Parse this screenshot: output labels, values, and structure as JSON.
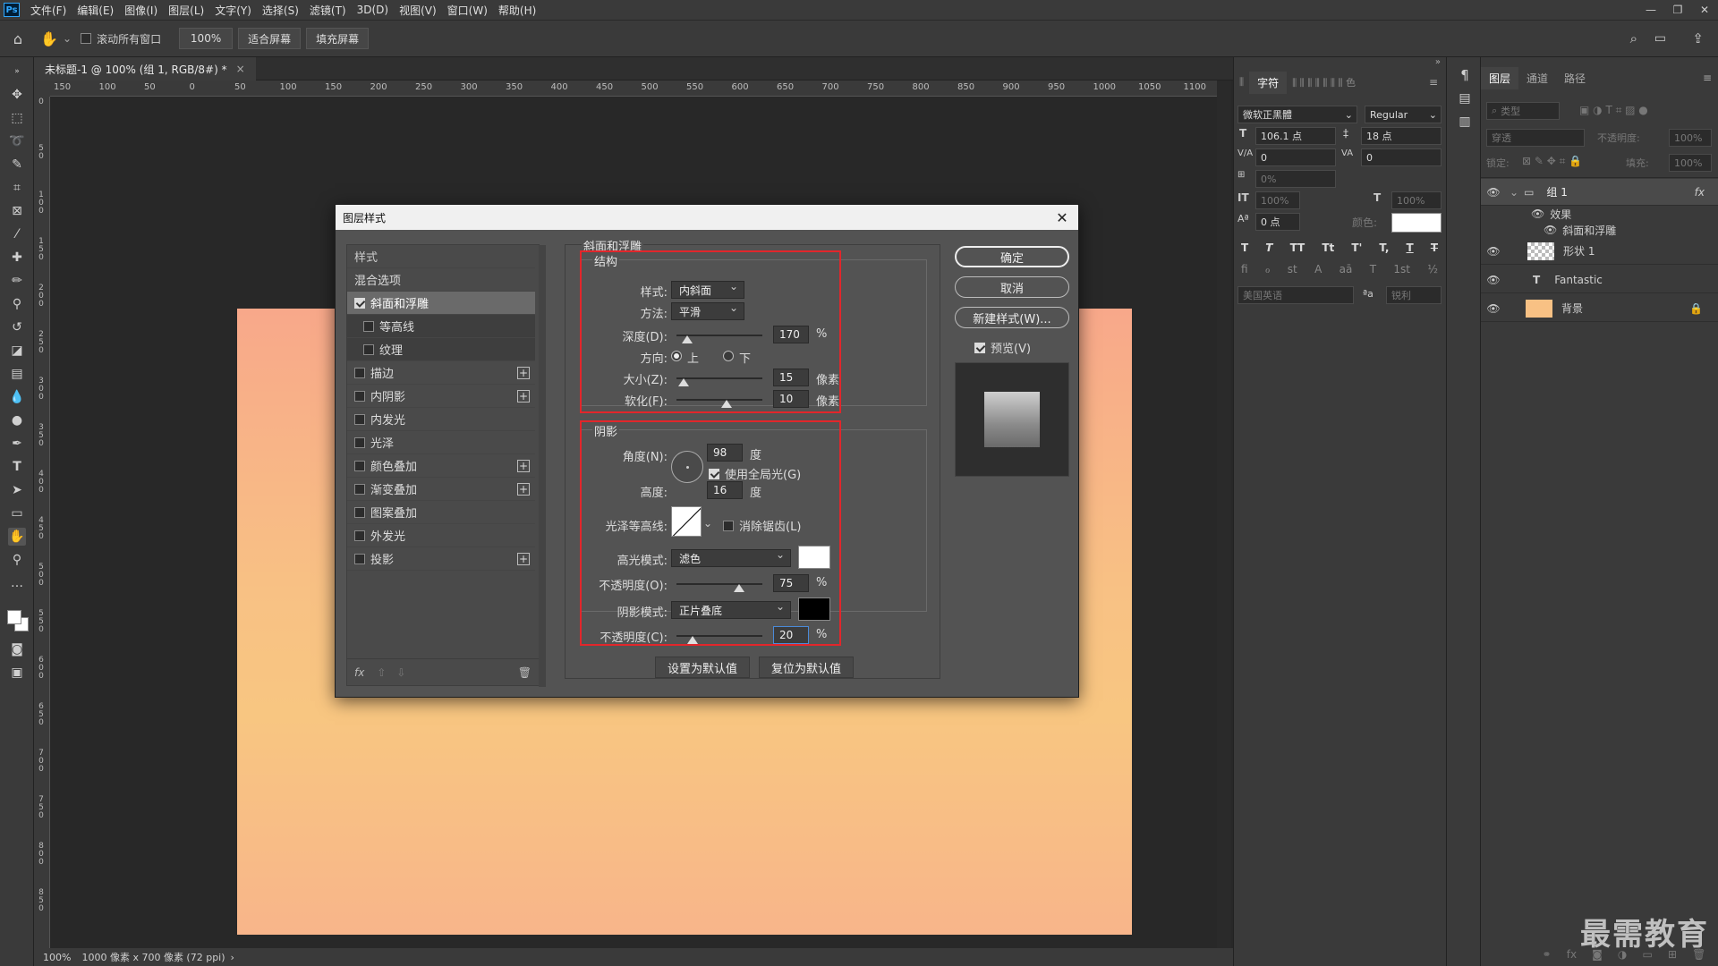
{
  "app": {
    "logo": "Ps",
    "menu": [
      "文件(F)",
      "编辑(E)",
      "图像(I)",
      "图层(L)",
      "文字(Y)",
      "选择(S)",
      "滤镜(T)",
      "3D(D)",
      "视图(V)",
      "窗口(W)",
      "帮助(H)"
    ],
    "win_controls": [
      "—",
      "❐",
      "✕"
    ]
  },
  "options": {
    "scroll_all": "滚动所有窗口",
    "zoom": "100%",
    "fit_screen": "适合屏幕",
    "fill_screen": "填充屏幕"
  },
  "document": {
    "tab_title": "未标题-1 @ 100% (组 1, RGB/8#) *",
    "tab_close": "×"
  },
  "rulers": {
    "h": [
      "150",
      "100",
      "50",
      "0",
      "50",
      "100",
      "150",
      "200",
      "250",
      "300",
      "350",
      "400",
      "450",
      "500",
      "550",
      "600",
      "650",
      "700",
      "750",
      "800",
      "850",
      "900",
      "950",
      "1000",
      "1050",
      "1100"
    ],
    "v": [
      "0",
      "5 0",
      "1 0 0",
      "1 5 0",
      "2 0 0",
      "2 5 0",
      "3 0 0",
      "3 5 0",
      "4 0 0",
      "4 5 0",
      "5 0 0",
      "5 5 0",
      "6 0 0",
      "6 5 0",
      "7 0 0",
      "7 5 0",
      "8 0 0",
      "8 5 0"
    ]
  },
  "status": {
    "zoom": "100%",
    "info": "1000 像素 x 700 像素 (72 ppi)",
    "arrow": "›"
  },
  "char_panel": {
    "tabs": [
      "字符"
    ],
    "font": "微软正黑體",
    "style": "Regular",
    "size": "106.1 点",
    "leading": "18 点",
    "kerning": "0",
    "tracking": "0",
    "scale": "0%",
    "v_scale": "100%",
    "h_scale": "100%",
    "baseline": "0 点",
    "color_label": "颜色:",
    "color": "#ffffff",
    "lang": "美国英语",
    "aa_label": "ªa",
    "aa": "锐利",
    "t_styles": [
      "T",
      "T",
      "TT",
      "Tt",
      "T'",
      "T,",
      "T",
      "T"
    ],
    "ot_styles": [
      "fi",
      "ℴ",
      "st",
      "A",
      "aā",
      "T",
      "1st",
      "½"
    ]
  },
  "layers_panel": {
    "tabs": [
      "图层",
      "通道",
      "路径"
    ],
    "filter": "类型",
    "blend": "穿透",
    "opacity_label": "不透明度:",
    "opacity": "100%",
    "lock_label": "锁定:",
    "fill_label": "填充:",
    "fill": "100%",
    "layers": [
      {
        "name": "组 1",
        "fx": "fx"
      },
      {
        "name": "效果"
      },
      {
        "name": "斜面和浮雕"
      },
      {
        "name": "形状 1"
      },
      {
        "name": "Fantastic",
        "icon": "T"
      },
      {
        "name": "背景"
      }
    ]
  },
  "dialog": {
    "title": "图层样式",
    "close": "✕",
    "list_header": "样式",
    "blend_options": "混合选项",
    "items": [
      "斜面和浮雕",
      "等高线",
      "纹理",
      "描边",
      "内阴影",
      "内发光",
      "光泽",
      "颜色叠加",
      "渐变叠加",
      "图案叠加",
      "外发光",
      "投影"
    ],
    "section_title": "斜面和浮雕",
    "structure": {
      "title": "结构",
      "style_label": "样式:",
      "style": "内斜面",
      "method_label": "方法:",
      "method": "平滑",
      "depth_label": "深度(D):",
      "depth": "170",
      "depth_unit": "%",
      "direction_label": "方向:",
      "dir_up": "上",
      "dir_down": "下",
      "size_label": "大小(Z):",
      "size": "15",
      "size_unit": "像素",
      "soften_label": "软化(F):",
      "soften": "10",
      "soften_unit": "像素"
    },
    "shading": {
      "title": "阴影",
      "angle_label": "角度(N):",
      "angle": "98",
      "angle_unit": "度",
      "global_light": "使用全局光(G)",
      "altitude_label": "高度:",
      "altitude": "16",
      "altitude_unit": "度",
      "gloss_label": "光泽等高线:",
      "antialias": "消除锯齿(L)",
      "hl_mode_label": "高光模式:",
      "hl_mode": "滤色",
      "hl_color": "#ffffff",
      "hl_opacity_label": "不透明度(O):",
      "hl_opacity": "75",
      "pct": "%",
      "sh_mode_label": "阴影模式:",
      "sh_mode": "正片叠底",
      "sh_color": "#000000",
      "sh_opacity_label": "不透明度(C):",
      "sh_opacity": "20"
    },
    "make_default": "设置为默认值",
    "reset_default": "复位为默认值",
    "ok": "确定",
    "cancel": "取消",
    "new_style": "新建样式(W)...",
    "preview": "预览(V)",
    "fx": "fx"
  },
  "watermark": "最需教育"
}
